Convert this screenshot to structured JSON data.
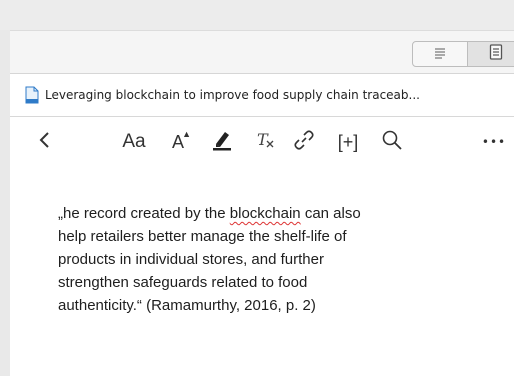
{
  "tab": {
    "title": "Leveraging blockchain to improve food supply chain traceab...",
    "icon": "document-icon"
  },
  "view_toggle": [
    {
      "icon": "text-lines-icon"
    },
    {
      "icon": "document-view-icon"
    }
  ],
  "toolbar": {
    "font_label": "Aa",
    "font_size_label": "A",
    "insert_label": "[+]",
    "more_label": "•••",
    "icons": [
      "back-chevron-icon",
      "font-icon",
      "font-size-icon",
      "highlighter-icon",
      "clear-format-icon",
      "link-icon",
      "insert-icon",
      "search-icon",
      "more-icon"
    ]
  },
  "quote": {
    "l1_pre": "„he record created by the ",
    "l1_misspelled": "blockchain",
    "l1_post": " can also",
    "l2": "help retailers better manage the shelf-life of",
    "l3": "products in individual stores, and further",
    "l4": "strengthen safeguards related to food",
    "l5": "authenticity.“ (Ramamurthy, 2016, p. 2)"
  },
  "colors": {
    "accent_underline": "#d33",
    "background": "#ffffff",
    "chrome": "#ececec"
  }
}
